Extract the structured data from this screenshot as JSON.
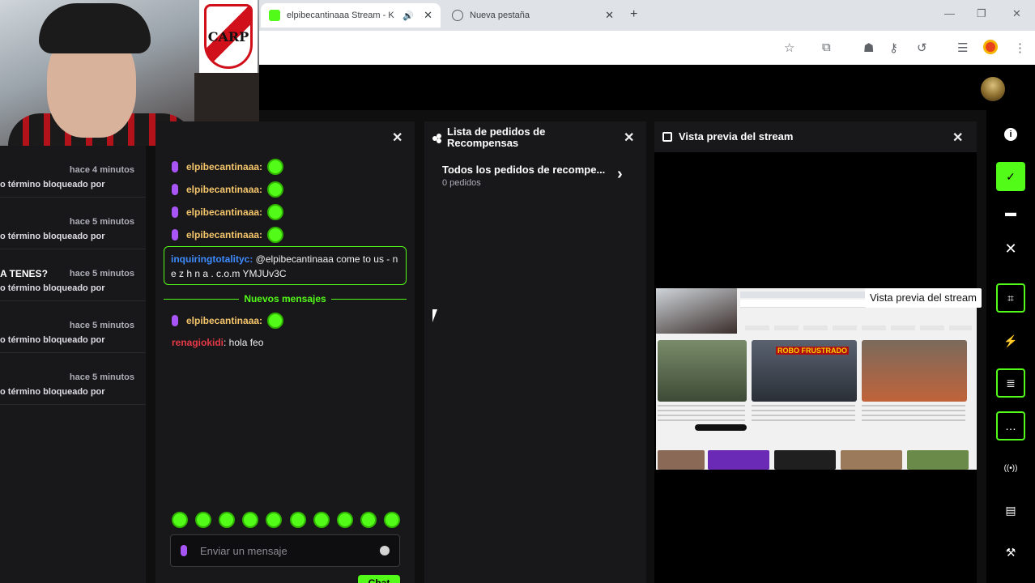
{
  "browser": {
    "tabs": [
      {
        "title": "elpibecantinaaa Stream - K",
        "active": true,
        "favicon_color": "#53fc18"
      },
      {
        "title": "Nueva pestaña",
        "active": false
      }
    ],
    "new_tab": "+",
    "window_controls": {
      "minimize": "—",
      "maximize": "❐",
      "close": "✕"
    },
    "toolbar_icons": [
      "star-icon",
      "extensions-icon",
      "incognito-icon",
      "password-key-icon",
      "history-icon",
      "media-queue-icon",
      "profile-icon",
      "menu-icon"
    ]
  },
  "webcam": {
    "crest_text": "CARP"
  },
  "left_panel": {
    "items": [
      {
        "time": "hace 4 minutos",
        "text": "o término bloqueado por"
      },
      {
        "time": "hace 5 minutos",
        "text": "o término bloqueado por"
      },
      {
        "time": "hace 5 minutos",
        "text": "o término bloqueado por",
        "strong": "A TENES?"
      },
      {
        "time": "hace 5 minutos",
        "text": "o término bloqueado por"
      },
      {
        "time": "hace 5 minutos",
        "text": "o término bloqueado por"
      }
    ]
  },
  "chat": {
    "messages_top": [
      {
        "user": "elpibecantinaaa:"
      },
      {
        "user": "elpibecantinaaa:"
      },
      {
        "user": "elpibecantinaaa:"
      },
      {
        "user": "elpibecantinaaa:"
      }
    ],
    "highlighted": {
      "user": "inquiringtotalityc:",
      "text": " @elpibecantinaaa come to us - n e z h n a . c.o.m YMJUv3C"
    },
    "divider_label": "Nuevos mensajes",
    "message_after": {
      "user": "elpibecantinaaa:"
    },
    "message_last": {
      "user": "renagiokidi",
      "text": ": hola feo"
    },
    "input_placeholder": "Enviar un mensaje",
    "send_label": "Chat",
    "accent": "#53fc18"
  },
  "rewards": {
    "title": "Lista de pedidos de Recompensas",
    "row_title": "Todos los pedidos de recompe...",
    "row_sub": "0 pedidos"
  },
  "preview": {
    "title": "Vista previa del stream",
    "tooltip": "Vista previa del stream",
    "thumb_overlay_text": "ROBO FRUSTRADO"
  },
  "rail": {
    "buttons": [
      {
        "name": "info-icon",
        "glyph": "i"
      },
      {
        "name": "check-icon",
        "glyph": "✓"
      },
      {
        "name": "layout-icon",
        "glyph": "▬"
      },
      {
        "name": "close-icon",
        "glyph": "✕"
      },
      {
        "name": "stream-preview-icon",
        "glyph": "⌗"
      },
      {
        "name": "bolt-icon",
        "glyph": "⚡"
      },
      {
        "name": "notes-icon",
        "glyph": "≣"
      },
      {
        "name": "chat-bubble-icon",
        "glyph": "…"
      },
      {
        "name": "broadcast-icon",
        "glyph": "((•))"
      },
      {
        "name": "media-icon",
        "glyph": "▤"
      },
      {
        "name": "wrench-icon",
        "glyph": "⚒"
      }
    ]
  }
}
